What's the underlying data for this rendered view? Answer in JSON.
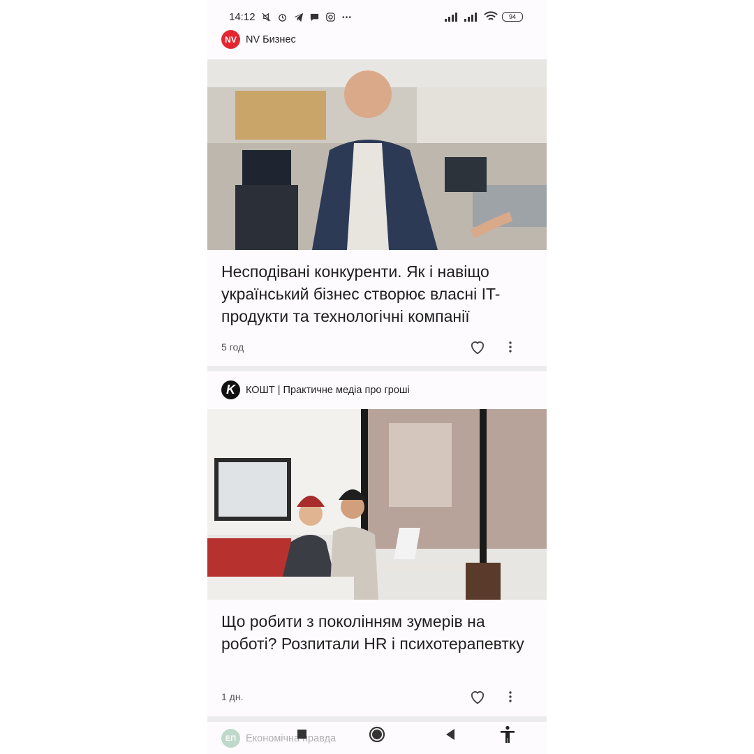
{
  "status_bar": {
    "time": "14:12",
    "battery": "94",
    "left_icons": [
      "muted-icon",
      "alarm-icon",
      "telegram-icon",
      "chat-icon",
      "instagram-icon",
      "more-icon"
    ],
    "right_icons": [
      "signal-icon",
      "signal-icon",
      "wifi-icon",
      "battery-icon"
    ]
  },
  "articles": [
    {
      "source": "NV Бизнес",
      "logo_text": "NV",
      "headline": "Несподівані конкуренти. Як і навіщо український бізнес створює власні IT-продукти та технологічні компанії",
      "age": "5 год"
    },
    {
      "source": "КОШТ | Практичне медіа про гроші",
      "logo_text": "K",
      "headline": "Що робити з поколінням зумерів на роботі? Розпитали HR і психотерапевтку",
      "age": "1 дн."
    }
  ],
  "next_source": {
    "name": "Економічна правда",
    "logo_text": "ЕП"
  },
  "nav": [
    "recents-icon",
    "home-icon",
    "back-icon",
    "accessibility-icon"
  ],
  "colors": {
    "nv_red": "#e3262f",
    "divider": "#ececef",
    "background": "#fdfbfd"
  }
}
